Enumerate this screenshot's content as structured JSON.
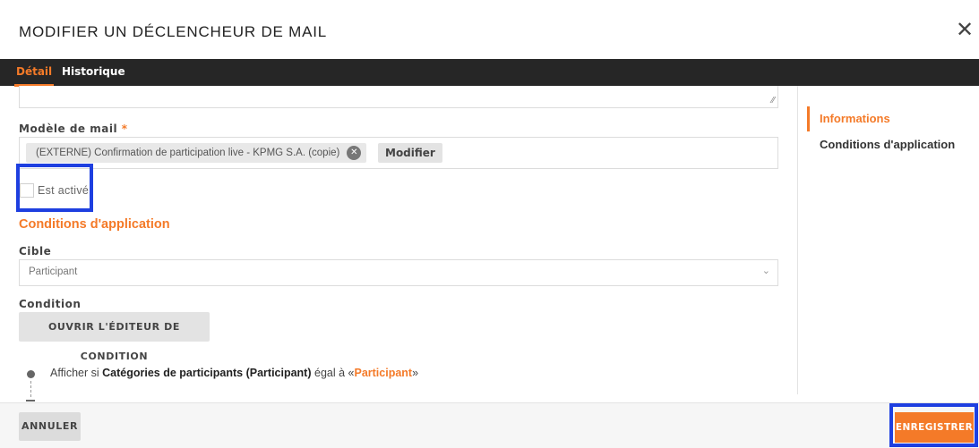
{
  "dialog": {
    "title": "MODIFIER UN DÉCLENCHEUR DE MAIL",
    "close_glyph": "✕"
  },
  "tabs": [
    {
      "label": "Détail",
      "active": true
    },
    {
      "label": "Historique",
      "active": false
    }
  ],
  "form": {
    "textarea_grip": "⁄⁄",
    "mail_template_label": "Modèle de mail",
    "required_mark": "*",
    "mail_template_value": "(EXTERNE) Confirmation de participation live - KPMG S.A. (copie)",
    "chip_remove_glyph": "✕",
    "modify_button": "Modifier",
    "is_active_label": "Est activé",
    "is_active_checked": false,
    "conditions_title": "Conditions d'application",
    "target_label": "Cible",
    "target_value": "Participant",
    "target_chevron": "⌄",
    "condition_label": "Condition",
    "open_editor_button": "OUVRIR L'ÉDITEUR DE CONDITION",
    "condition_rule": {
      "prefix": "Afficher si ",
      "field": "Catégories de participants (Participant)",
      "operator": " égal à «",
      "value": "Participant",
      "suffix": "»"
    }
  },
  "sidebar": {
    "items": [
      {
        "label": "Informations",
        "active": true
      },
      {
        "label": "Conditions d'application",
        "active": false
      }
    ]
  },
  "footer": {
    "cancel_button": "ANNULER",
    "save_button": "ENREGISTRER"
  },
  "colors": {
    "accent": "#f47a28",
    "tab_bar": "#262626",
    "highlight": "#1e3fe0"
  }
}
